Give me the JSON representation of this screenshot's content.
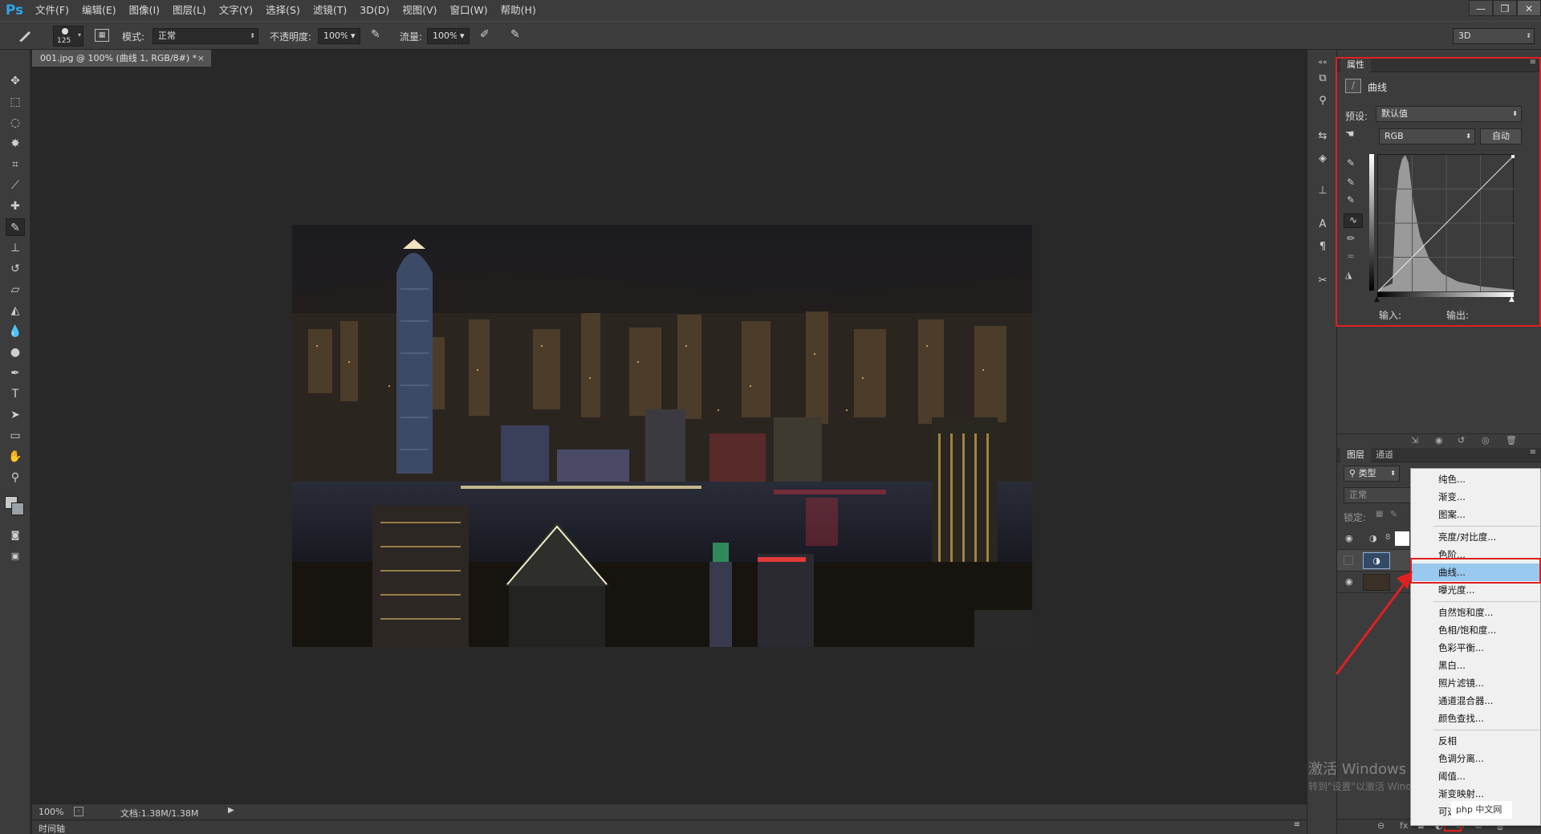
{
  "app": {
    "logo": "Ps",
    "menu": [
      "文件(F)",
      "编辑(E)",
      "图像(I)",
      "图层(L)",
      "文字(Y)",
      "选择(S)",
      "滤镜(T)",
      "3D(D)",
      "视图(V)",
      "窗口(W)",
      "帮助(H)"
    ],
    "window_controls": [
      "—",
      "❐",
      "✕"
    ]
  },
  "options_bar": {
    "brush_size": "125",
    "mode_label": "模式:",
    "mode_value": "正常",
    "opacity_label": "不透明度:",
    "opacity_value": "100%",
    "flow_label": "流量:",
    "flow_value": "100%",
    "workspace": "3D"
  },
  "document": {
    "tab_title": "001.jpg @ 100% (曲线 1, RGB/8#) *",
    "tab_close": "×",
    "zoom": "100%",
    "doc_info": "文档:1.38M/1.38M",
    "timeline": "时间轴"
  },
  "properties_panel": {
    "tab": "属性",
    "title": "曲线",
    "preset_label": "预设:",
    "preset_value": "默认值",
    "channel_value": "RGB",
    "auto_button": "自动",
    "input_label": "输入:",
    "output_label": "输出:"
  },
  "layers_panel": {
    "tabs": [
      "图层",
      "通道"
    ],
    "filter_label": "类型",
    "blend_mode": "正常",
    "lock_label": "锁定:"
  },
  "context_menu": {
    "items": [
      {
        "label": "纯色...",
        "selected": false
      },
      {
        "label": "渐变...",
        "selected": false
      },
      {
        "label": "图案...",
        "selected": false
      },
      {
        "label": "亮度/对比度...",
        "selected": false
      },
      {
        "label": "色阶...",
        "selected": false
      },
      {
        "label": "曲线...",
        "selected": true
      },
      {
        "label": "曝光度...",
        "selected": false
      },
      {
        "label": "自然饱和度...",
        "selected": false
      },
      {
        "label": "色相/饱和度...",
        "selected": false
      },
      {
        "label": "色彩平衡...",
        "selected": false
      },
      {
        "label": "黑白...",
        "selected": false
      },
      {
        "label": "照片滤镜...",
        "selected": false
      },
      {
        "label": "通道混合器...",
        "selected": false
      },
      {
        "label": "颜色查找...",
        "selected": false
      },
      {
        "label": "反相",
        "selected": false
      },
      {
        "label": "色调分离...",
        "selected": false
      },
      {
        "label": "阈值...",
        "selected": false
      },
      {
        "label": "渐变映射...",
        "selected": false
      },
      {
        "label": "可选颜色...",
        "selected": false
      }
    ]
  },
  "overlay": {
    "watermark_title": "激活 Windows",
    "watermark_sub": "转到\"设置\"以激活 Windows。",
    "badge": "php 中文网"
  },
  "colors": {
    "highlight_red": "#e02020",
    "menu_selected": "#99c9ef",
    "ps_blue": "#2ea3e8"
  }
}
